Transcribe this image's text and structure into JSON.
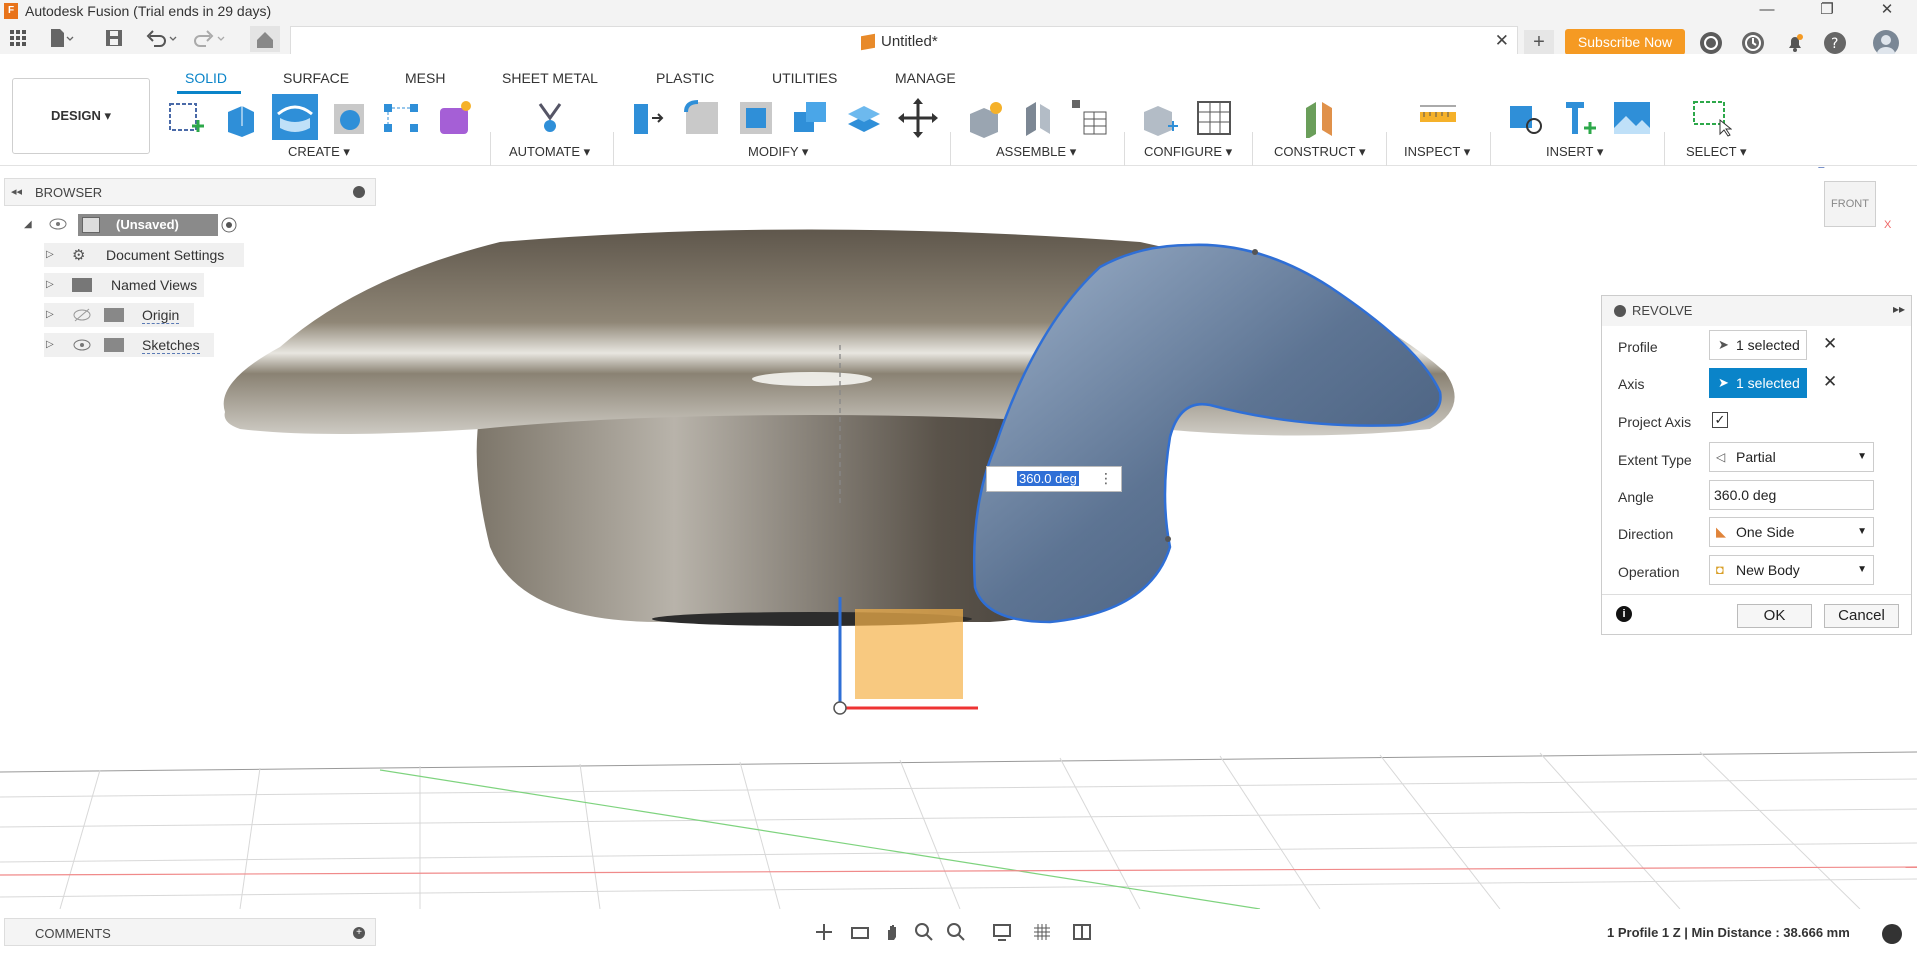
{
  "window": {
    "title": "Autodesk Fusion (Trial ends in 29 days)",
    "logo_letter": "F",
    "minimize": "—",
    "restore": "❐",
    "close": "✕"
  },
  "tabbar": {
    "doc_title": "Untitled*",
    "close": "✕",
    "new_tab": "+",
    "subscribe": "Subscribe Now"
  },
  "workspace": {
    "label": "DESIGN ▾"
  },
  "toolbar": {
    "tabs": [
      "SOLID",
      "SURFACE",
      "MESH",
      "SHEET METAL",
      "PLASTIC",
      "UTILITIES",
      "MANAGE"
    ],
    "groups": {
      "create": "CREATE ▾",
      "automate": "AUTOMATE ▾",
      "modify": "MODIFY ▾",
      "assemble": "ASSEMBLE ▾",
      "configure": "CONFIGURE ▾",
      "construct": "CONSTRUCT ▾",
      "inspect": "INSPECT ▾",
      "insert": "INSERT ▾",
      "select": "SELECT ▾"
    }
  },
  "browser": {
    "title": "BROWSER",
    "root": "(Unsaved)",
    "items": [
      "Document Settings",
      "Named Views",
      "Origin",
      "Sketches"
    ]
  },
  "viewcube": {
    "face": "FRONT",
    "axis_z": "Z",
    "axis_x": "X"
  },
  "revolve": {
    "title": "REVOLVE",
    "profile_label": "Profile",
    "profile_value": "1 selected",
    "axis_label": "Axis",
    "axis_value": "1 selected",
    "project_axis_label": "Project Axis",
    "project_axis_checked": true,
    "extent_label": "Extent Type",
    "extent_value": "Partial",
    "angle_label": "Angle",
    "angle_value": "360.0 deg",
    "direction_label": "Direction",
    "direction_value": "One Side",
    "operation_label": "Operation",
    "operation_value": "New Body",
    "ok": "OK",
    "cancel": "Cancel",
    "clear": "✕"
  },
  "angle_input": "360.0 deg",
  "comments": {
    "label": "COMMENTS"
  },
  "status_text": "1 Profile 1 Z | Min Distance : 38.666 mm",
  "colors": {
    "accent": "#0a84c9",
    "subscribe": "#f59a23",
    "selection": "#2f6fd6"
  }
}
